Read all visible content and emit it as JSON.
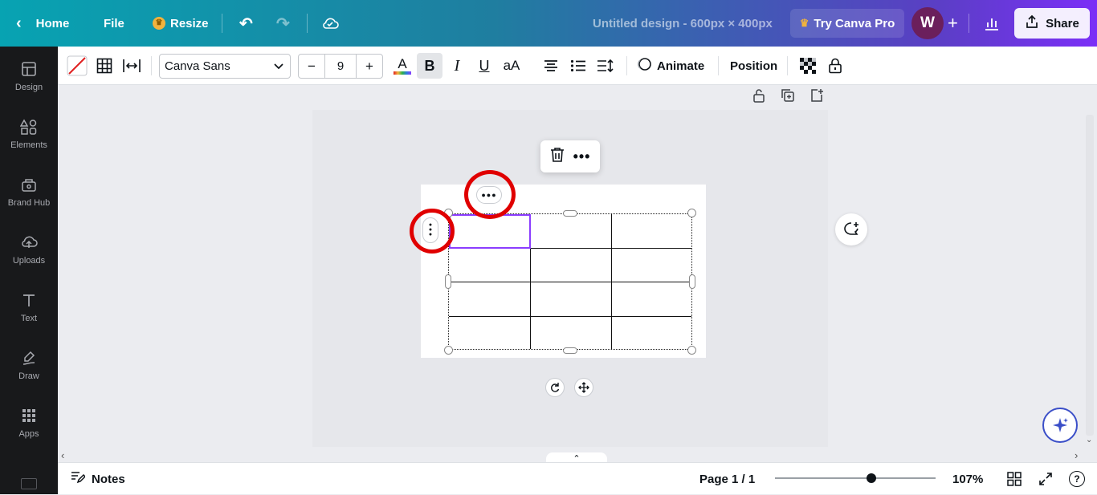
{
  "topbar": {
    "back_icon": "chevron-left-icon",
    "home_label": "Home",
    "file_label": "File",
    "resize_label": "Resize",
    "design_title": "Untitled design - 600px × 400px",
    "pro_label": "Try Canva Pro",
    "avatar_letter": "W",
    "share_label": "Share"
  },
  "sidebar": {
    "items": [
      {
        "label": "Design",
        "icon": "layout-icon"
      },
      {
        "label": "Elements",
        "icon": "shapes-icon"
      },
      {
        "label": "Brand Hub",
        "icon": "brand-icon"
      },
      {
        "label": "Uploads",
        "icon": "upload-icon"
      },
      {
        "label": "Text",
        "icon": "text-icon"
      },
      {
        "label": "Draw",
        "icon": "draw-icon"
      },
      {
        "label": "Apps",
        "icon": "apps-icon"
      }
    ]
  },
  "toolbar": {
    "font_name": "Canva Sans",
    "font_size": "9",
    "minus": "−",
    "plus": "+",
    "bold": "B",
    "italic": "I",
    "underline": "U",
    "case": "aA",
    "animate_label": "Animate",
    "position_label": "Position"
  },
  "context_menu": {
    "delete_icon": "trash-icon",
    "more_icon": "more-icon"
  },
  "table": {
    "rows": 4,
    "cols": 3,
    "selected_cell": "row 1, col 1"
  },
  "bottombar": {
    "notes_label": "Notes",
    "page_label": "Page 1 / 1",
    "zoom_label": "107%",
    "zoom_level": 0.6
  },
  "colors": {
    "accent": "#8b3dff",
    "highlight": "#e00000"
  }
}
